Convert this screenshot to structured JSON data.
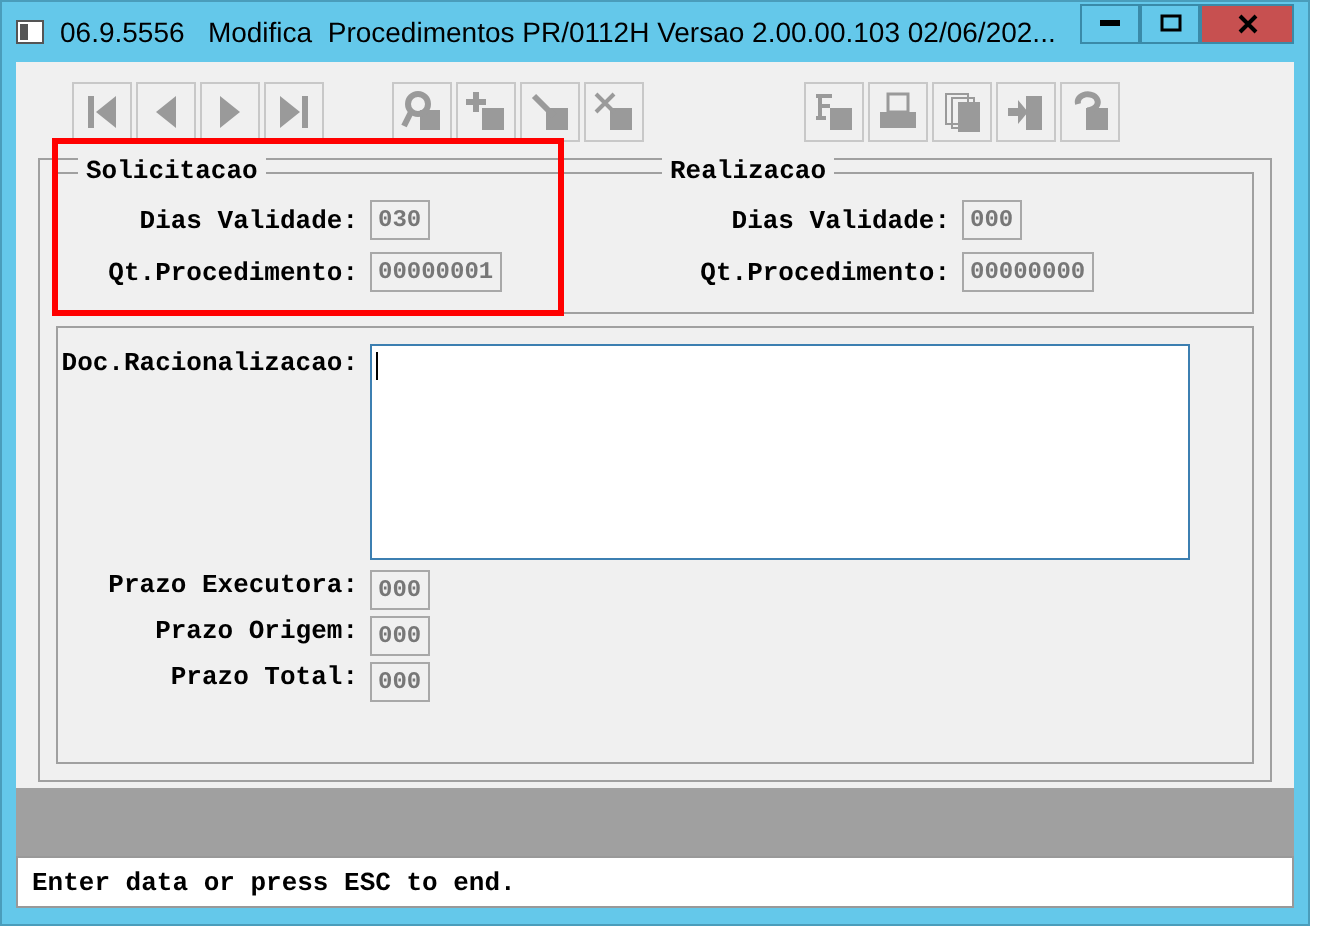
{
  "window": {
    "title": "06.9.5556   Modifica  Procedimentos PR/0112H Versao 2.00.00.103 02/06/202..."
  },
  "toolbar": [
    {
      "kind": "first",
      "disabled": true
    },
    {
      "kind": "prev",
      "disabled": true
    },
    {
      "kind": "next",
      "disabled": true
    },
    {
      "kind": "last",
      "disabled": true
    },
    {
      "kind": "search",
      "disabled": true
    },
    {
      "kind": "add",
      "disabled": true
    },
    {
      "kind": "edit",
      "disabled": true
    },
    {
      "kind": "delete",
      "disabled": true
    },
    {
      "kind": "filter",
      "disabled": true
    },
    {
      "kind": "print",
      "disabled": true
    },
    {
      "kind": "copy",
      "disabled": true
    },
    {
      "kind": "exit",
      "disabled": true
    },
    {
      "kind": "help",
      "disabled": true
    }
  ],
  "groups": [
    {
      "title": "Solicitacao",
      "highlighted": true,
      "fields": [
        {
          "label": "Dias Validade:",
          "value": "030"
        },
        {
          "label": "Qt.Procedimento:",
          "value": "00000001"
        }
      ]
    },
    {
      "title": "Realizacao",
      "highlighted": false,
      "fields": [
        {
          "label": "Dias Validade:",
          "value": "000"
        },
        {
          "label": "Qt.Procedimento:",
          "value": "00000000"
        }
      ]
    }
  ],
  "doc": {
    "label": "Doc.Racionalizacao:",
    "fields": [
      {
        "label": "Prazo Executora:",
        "value": "000"
      },
      {
        "label": "Prazo Origem:",
        "value": "000"
      },
      {
        "label": "Prazo Total:",
        "value": "000"
      }
    ]
  },
  "status_bar": "Enter data or press ESC to end."
}
